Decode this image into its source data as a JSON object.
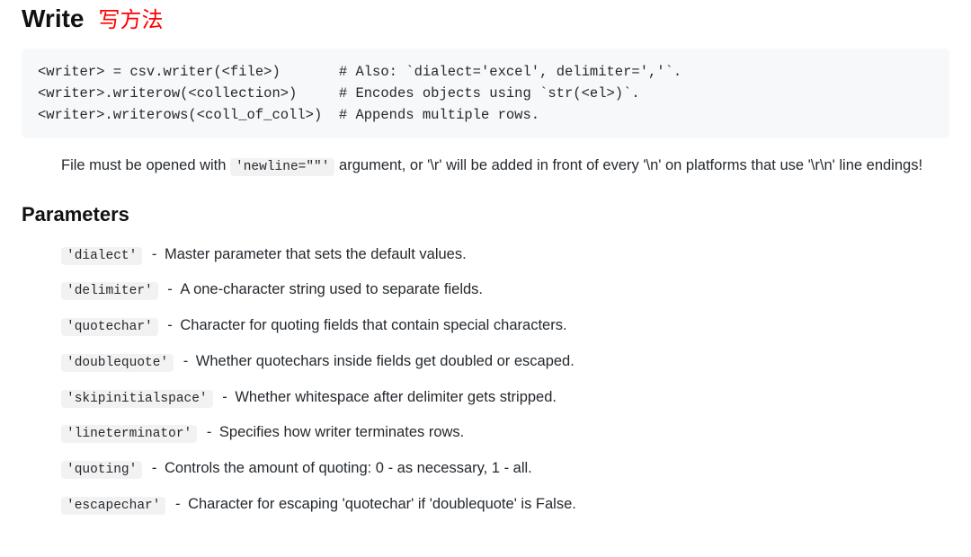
{
  "heading": {
    "title": "Write",
    "annotation": "写方法"
  },
  "code": "<writer> = csv.writer(<file>)       # Also: `dialect='excel', delimiter=','`.\n<writer>.writerow(<collection>)     # Encodes objects using `str(<el>)`.\n<writer>.writerows(<coll_of_coll>)  # Appends multiple rows.",
  "note": {
    "pre": "File must be opened with ",
    "code": "'newline=\"\"'",
    "post": " argument, or '\\r' will be added in front of every '\\n' on platforms that use '\\r\\n' line endings!"
  },
  "parameters_heading": "Parameters",
  "parameters": [
    {
      "name": "'dialect'",
      "desc": "Master parameter that sets the default values."
    },
    {
      "name": "'delimiter'",
      "desc": "A one-character string used to separate fields."
    },
    {
      "name": "'quotechar'",
      "desc": "Character for quoting fields that contain special characters."
    },
    {
      "name": "'doublequote'",
      "desc": "Whether quotechars inside fields get doubled or escaped."
    },
    {
      "name": "'skipinitialspace'",
      "desc": "Whether whitespace after delimiter gets stripped."
    },
    {
      "name": "'lineterminator'",
      "desc": "Specifies how writer terminates rows."
    },
    {
      "name": "'quoting'",
      "desc": "Controls the amount of quoting: 0 - as necessary, 1 - all."
    },
    {
      "name": "'escapechar'",
      "desc": "Character for escaping 'quotechar' if 'doublequote' is False."
    }
  ]
}
